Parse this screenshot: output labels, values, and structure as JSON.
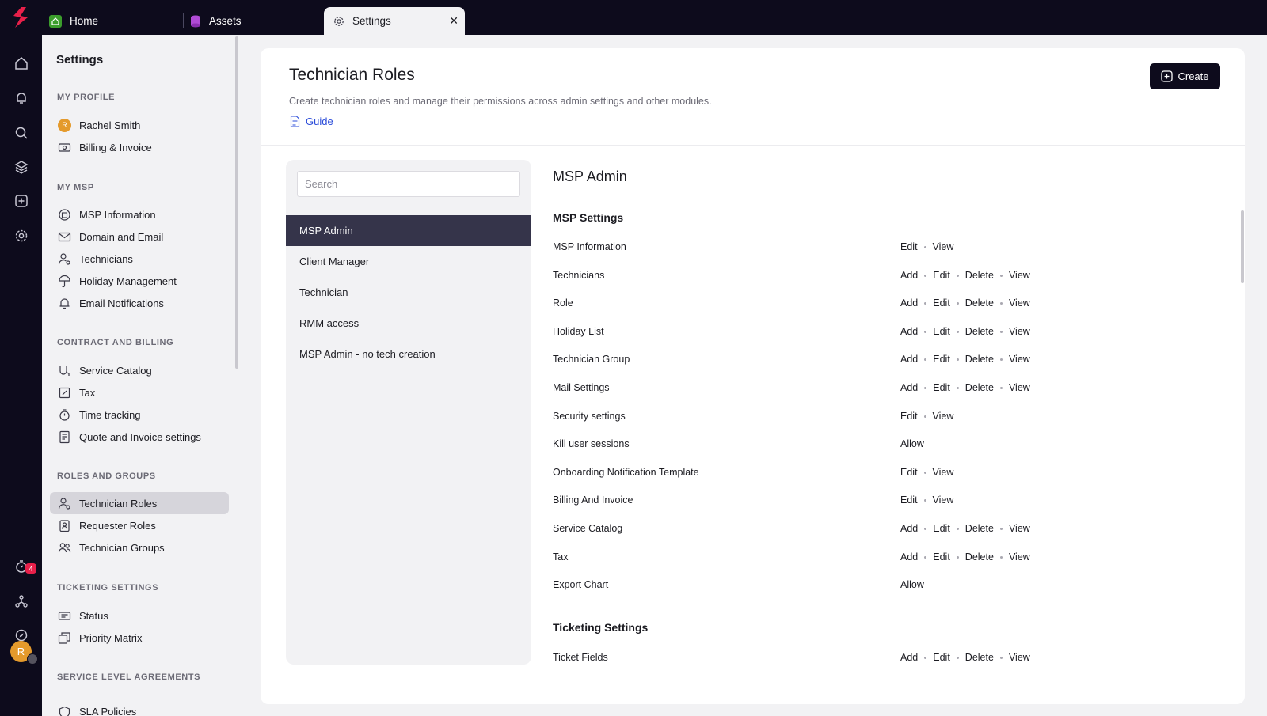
{
  "tabs": [
    {
      "label": "Home",
      "icon": "home-icon"
    },
    {
      "label": "Assets",
      "icon": "assets-icon"
    },
    {
      "label": "Settings",
      "icon": "gear-icon",
      "active": true
    }
  ],
  "rail": {
    "items": [
      "home-icon",
      "bell-icon",
      "search-icon",
      "layers-icon",
      "plus-square-icon",
      "gear-icon",
      "timer-icon",
      "network-icon",
      "compass-icon"
    ],
    "timer_badge": "4",
    "avatar_initial": "R"
  },
  "sidebar": {
    "title": "Settings",
    "sections": [
      {
        "label": "MY PROFILE",
        "items": [
          {
            "label": "Rachel Smith",
            "icon": "avatar",
            "initial": "R"
          },
          {
            "label": "Billing & Invoice",
            "icon": "billing-icon"
          }
        ]
      },
      {
        "label": "MY MSP",
        "items": [
          {
            "label": "MSP Information",
            "icon": "building-icon"
          },
          {
            "label": "Domain and Email",
            "icon": "mail-icon"
          },
          {
            "label": "Technicians",
            "icon": "user-gear-icon"
          },
          {
            "label": "Holiday Management",
            "icon": "umbrella-icon"
          },
          {
            "label": "Email Notifications",
            "icon": "bell-icon"
          }
        ]
      },
      {
        "label": "CONTRACT AND BILLING",
        "items": [
          {
            "label": "Service Catalog",
            "icon": "catalog-icon"
          },
          {
            "label": "Tax",
            "icon": "tax-icon"
          },
          {
            "label": "Time tracking",
            "icon": "stopwatch-icon"
          },
          {
            "label": "Quote and Invoice settings",
            "icon": "invoice-icon"
          }
        ]
      },
      {
        "label": "ROLES AND GROUPS",
        "items": [
          {
            "label": "Technician Roles",
            "icon": "user-gear-icon",
            "active": true
          },
          {
            "label": "Requester Roles",
            "icon": "badge-icon"
          },
          {
            "label": "Technician Groups",
            "icon": "users-icon"
          }
        ]
      },
      {
        "label": "TICKETING SETTINGS",
        "items": [
          {
            "label": "Status",
            "icon": "ticket-icon"
          },
          {
            "label": "Priority Matrix",
            "icon": "matrix-icon"
          }
        ]
      },
      {
        "label": "SERVICE LEVEL AGREEMENTS",
        "items": [
          {
            "label": "SLA Policies",
            "icon": "shield-icon"
          }
        ]
      }
    ]
  },
  "page": {
    "title": "Technician Roles",
    "description": "Create technician roles and manage their permissions across admin settings and other modules.",
    "guide_label": "Guide",
    "create_label": "Create"
  },
  "roles": {
    "search_placeholder": "Search",
    "items": [
      "MSP Admin",
      "Client Manager",
      "Technician",
      "RMM access",
      "MSP Admin - no tech creation"
    ],
    "active_index": 0
  },
  "permissions": {
    "role_title": "MSP Admin",
    "sections": [
      {
        "title": "MSP Settings",
        "rows": [
          {
            "name": "MSP Information",
            "actions": [
              "Edit",
              "View"
            ]
          },
          {
            "name": "Technicians",
            "actions": [
              "Add",
              "Edit",
              "Delete",
              "View"
            ]
          },
          {
            "name": "Role",
            "actions": [
              "Add",
              "Edit",
              "Delete",
              "View"
            ]
          },
          {
            "name": "Holiday List",
            "actions": [
              "Add",
              "Edit",
              "Delete",
              "View"
            ]
          },
          {
            "name": "Technician Group",
            "actions": [
              "Add",
              "Edit",
              "Delete",
              "View"
            ]
          },
          {
            "name": "Mail Settings",
            "actions": [
              "Add",
              "Edit",
              "Delete",
              "View"
            ]
          },
          {
            "name": "Security settings",
            "actions": [
              "Edit",
              "View"
            ]
          },
          {
            "name": "Kill user sessions",
            "actions": [
              "Allow"
            ]
          },
          {
            "name": "Onboarding Notification Template",
            "actions": [
              "Edit",
              "View"
            ]
          },
          {
            "name": "Billing And Invoice",
            "actions": [
              "Edit",
              "View"
            ]
          },
          {
            "name": "Service Catalog",
            "actions": [
              "Add",
              "Edit",
              "Delete",
              "View"
            ]
          },
          {
            "name": "Tax",
            "actions": [
              "Add",
              "Edit",
              "Delete",
              "View"
            ]
          },
          {
            "name": "Export Chart",
            "actions": [
              "Allow"
            ]
          }
        ]
      },
      {
        "title": "Ticketing Settings",
        "rows": [
          {
            "name": "Ticket Fields",
            "actions": [
              "Add",
              "Edit",
              "Delete",
              "View"
            ]
          }
        ]
      }
    ]
  },
  "colors": {
    "topbar": "#0d0b1c",
    "accent_link": "#2a4bd9",
    "active_role": "#35344a",
    "badge": "#e8204a",
    "home_tab": "#3b9d2c",
    "assets_tab": "#b04bd6"
  }
}
